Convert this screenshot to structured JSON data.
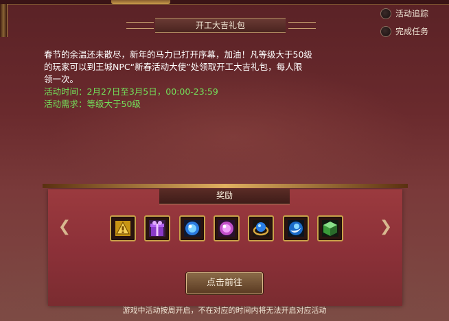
{
  "title": "开工大吉礼包",
  "tracking": {
    "activity_label": "活动追踪",
    "complete_label": "完成任务"
  },
  "description": {
    "line1": "春节的余温还未散尽，新年的马力已打开序幕，加油！凡等级大于50级",
    "line2": "的玩家可以到王城NPC“新春活动大使”处领取开工大吉礼包，每人限",
    "line3": "领一次。",
    "time_line": "活动时间：2月27日至3月5日，00:00-23:59",
    "requirement_line": "活动需求：等级大于50级"
  },
  "rewards": {
    "title": "奖励",
    "items": [
      "yellow-scroll-icon",
      "purple-gift-box-icon",
      "blue-orb-icon",
      "pink-orb-icon",
      "blue-gem-ring-icon",
      "blue-crescent-orb-icon",
      "green-cube-icon"
    ]
  },
  "go_button": "点击前往",
  "footer": "游戏中活动按周开启，不在对应的时间内将无法开启对应活动",
  "colors": {
    "accent_green": "#73e05a",
    "panel_red": "#8b3038",
    "gold_border": "#c9a24a"
  }
}
